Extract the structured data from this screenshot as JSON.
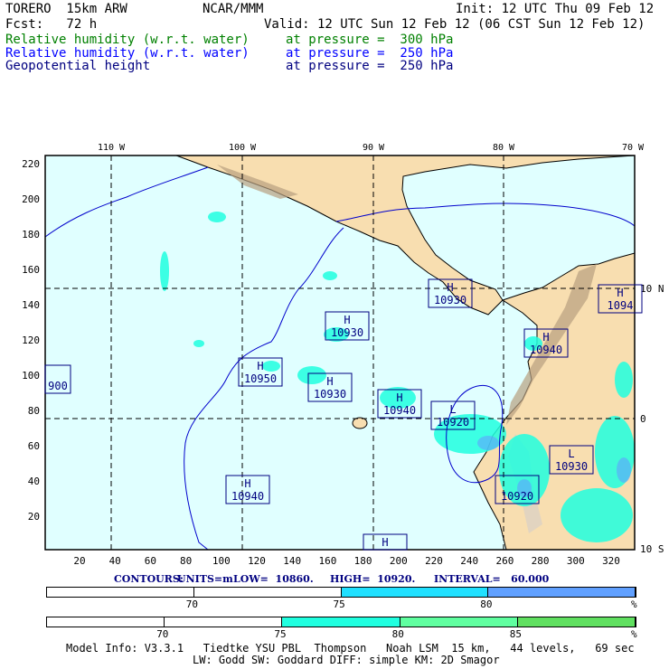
{
  "header": {
    "model": "TORERO  15km ARW",
    "org": "NCAR/MMM",
    "init": "Init: 12 UTC Thu 09 Feb 12",
    "fcst": "Fcst:   72 h",
    "valid": "Valid: 12 UTC Sun 12 Feb 12 (06 CST Sun 12 Feb 12)"
  },
  "fields": [
    {
      "name": "Relative humidity (w.r.t. water)",
      "level": "at pressure =  300 hPa",
      "color": "#008000"
    },
    {
      "name": "Relative humidity (w.r.t. water)",
      "level": "at pressure =  250 hPa",
      "color": "#0000ff"
    },
    {
      "name": "Geopotential height",
      "level": "at pressure =  250 hPa",
      "color": "#000080"
    }
  ],
  "axes": {
    "lon_labels": [
      "110 W",
      "100 W",
      "90 W",
      "80 W",
      "70 W"
    ],
    "lat_labels": [
      "10 N",
      "0",
      "10 S"
    ],
    "y_ticks": [
      "220",
      "200",
      "180",
      "160",
      "140",
      "120",
      "100",
      "80",
      "60",
      "40",
      "20"
    ],
    "x_ticks": [
      "20",
      "40",
      "60",
      "80",
      "100",
      "120",
      "140",
      "160",
      "180",
      "200",
      "220",
      "240",
      "260",
      "280",
      "300",
      "320"
    ]
  },
  "centers": [
    {
      "type": "H",
      "value": "10930"
    },
    {
      "type": "H",
      "value": "10930"
    },
    {
      "type": "H",
      "value": "10950"
    },
    {
      "type": "H",
      "value": "10930"
    },
    {
      "type": "H",
      "value": "10940"
    },
    {
      "type": "L",
      "value": "10920"
    },
    {
      "type": "H",
      "value": "10940"
    },
    {
      "type": "H",
      "value": "1094"
    },
    {
      "type": "",
      "value": "900"
    },
    {
      "type": "H",
      "value": "10940"
    },
    {
      "type": "L",
      "value": "10930"
    },
    {
      "type": "",
      "value": "10920"
    },
    {
      "type": "H",
      "value": ""
    }
  ],
  "contours": {
    "label": "CONTOURS:",
    "units": "UNITS=m",
    "low": "LOW=  10860.",
    "high": "HIGH=  10920.",
    "interval": "INTERVAL=   60.000"
  },
  "colorbar1": {
    "labels": [
      "70",
      "75",
      "80",
      "%"
    ],
    "colors": [
      "#ffffff",
      "#ffffff",
      "#20e0ff",
      "#60a0ff"
    ]
  },
  "colorbar2": {
    "labels": [
      "70",
      "75",
      "80",
      "85",
      "%"
    ],
    "colors": [
      "#ffffff",
      "#ffffff",
      "#20ffe0",
      "#60ffa0",
      "#60e060"
    ]
  },
  "footer": {
    "line1": "Model Info: V3.3.1   Tiedtke YSU PBL  Thompson   Noah LSM  15 km,   44 levels,   69 sec",
    "line2": "LW: Godd SW: Goddard DIFF: simple KM: 2D Smagor"
  }
}
